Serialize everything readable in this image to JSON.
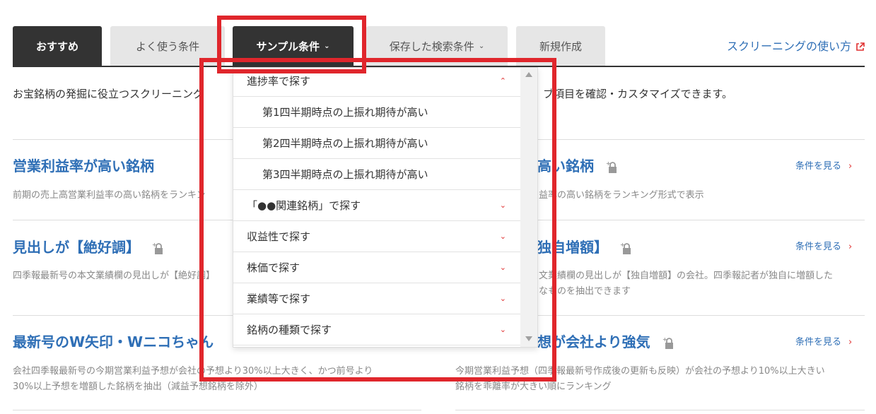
{
  "tabs": {
    "recommended": "おすすめ",
    "frequent": "よく使う条件",
    "sample": "サンプル条件",
    "saved": "保存した検索条件",
    "new": "新規作成"
  },
  "help_link": "スクリーニングの使い方",
  "intro": "お宝銘柄の発掘に役立つスクリーニング条件をご紹介します。条件を選んで表示項目を確認・カスタマイズできます。",
  "intro_visible": "お宝銘柄の発掘に役立つスクリーニング",
  "intro_right": "ブ項目を確認・カスタマイズできます。",
  "see_label": "条件を見る",
  "cards": {
    "c1": {
      "title": "営業利益率が高い銘柄",
      "desc": "前期の売上高営業利益率の高い銘柄をランキン"
    },
    "c2": {
      "title": "高い銘柄",
      "desc": "益率の高い銘柄をランキング形式で表示"
    },
    "c3": {
      "title": "見出しが【絶好調】",
      "desc": "四季報最新号の本文業績欄の見出しが【絶好調】"
    },
    "c4": {
      "title": "独自増額】",
      "desc1": "文業績欄の見出しが【独自増額】の会社。四季報記者が独自に増額した",
      "desc2": "なものを抽出できます"
    },
    "c5": {
      "title": "最新号のW矢印・Wニコちゃん",
      "desc1": "会社四季報最新号の今期営業利益予想が会社の予想より30%以上大きく、かつ前号より",
      "desc2": "30%以上予想を増額した銘柄を抽出（減益予想銘柄を除外）"
    },
    "c6": {
      "title": "想が会社より強気",
      "desc1": "今期営業利益予想（四季報最新号作成後の更新も反映）が会社の予想より10%以上大きい",
      "desc2": "銘柄を乖離率が大きい順にランキング"
    }
  },
  "dropdown": {
    "progress": "進捗率で探す",
    "q1": "第1四半期時点の上振れ期待が高い",
    "q2": "第2四半期時点の上振れ期待が高い",
    "q3": "第3四半期時点の上振れ期待が高い",
    "related": "「●●関連銘柄」で探す",
    "profit": "収益性で探す",
    "price": "株価で探す",
    "results": "業績等で探す",
    "type": "銘柄の種類で探す"
  },
  "colors": {
    "accent_link": "#2f6fb6",
    "chevron": "#e03030",
    "highlight": "#e0262c",
    "active_tab": "#333333"
  }
}
